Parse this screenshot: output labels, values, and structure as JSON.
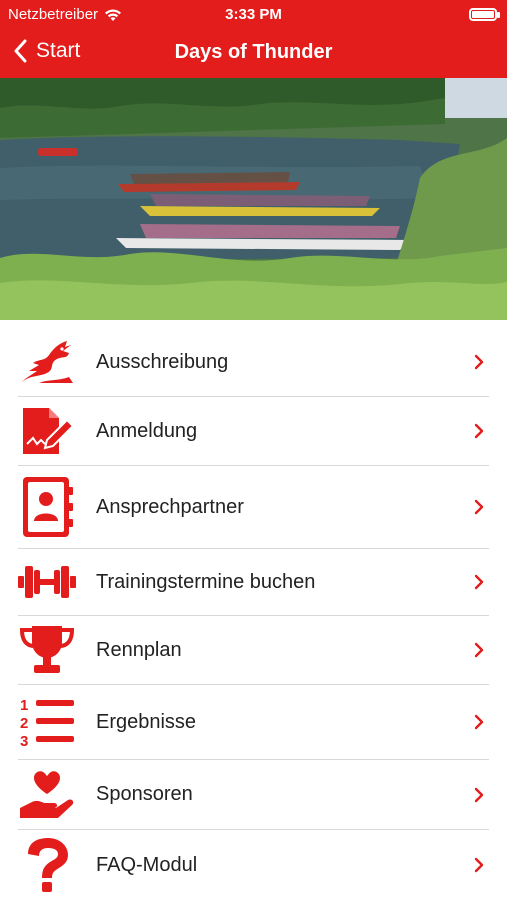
{
  "status_bar": {
    "carrier": "Netzbetreiber",
    "time": "3:33 PM"
  },
  "nav": {
    "back_label": "Start",
    "title": "Days of Thunder"
  },
  "colors": {
    "brand_red": "#e31c1c",
    "text": "#222222",
    "divider": "#d8d8d8"
  },
  "menu": {
    "items": [
      {
        "label": "Ausschreibung",
        "icon": "dragon-icon"
      },
      {
        "label": "Anmeldung",
        "icon": "edit-document-icon"
      },
      {
        "label": "Ansprechpartner",
        "icon": "address-book-icon"
      },
      {
        "label": "Trainingstermine buchen",
        "icon": "dumbbell-icon"
      },
      {
        "label": "Rennplan",
        "icon": "trophy-icon"
      },
      {
        "label": "Ergebnisse",
        "icon": "ranked-list-icon"
      },
      {
        "label": "Sponsoren",
        "icon": "heart-hand-icon"
      },
      {
        "label": "FAQ-Modul",
        "icon": "question-icon"
      }
    ]
  }
}
